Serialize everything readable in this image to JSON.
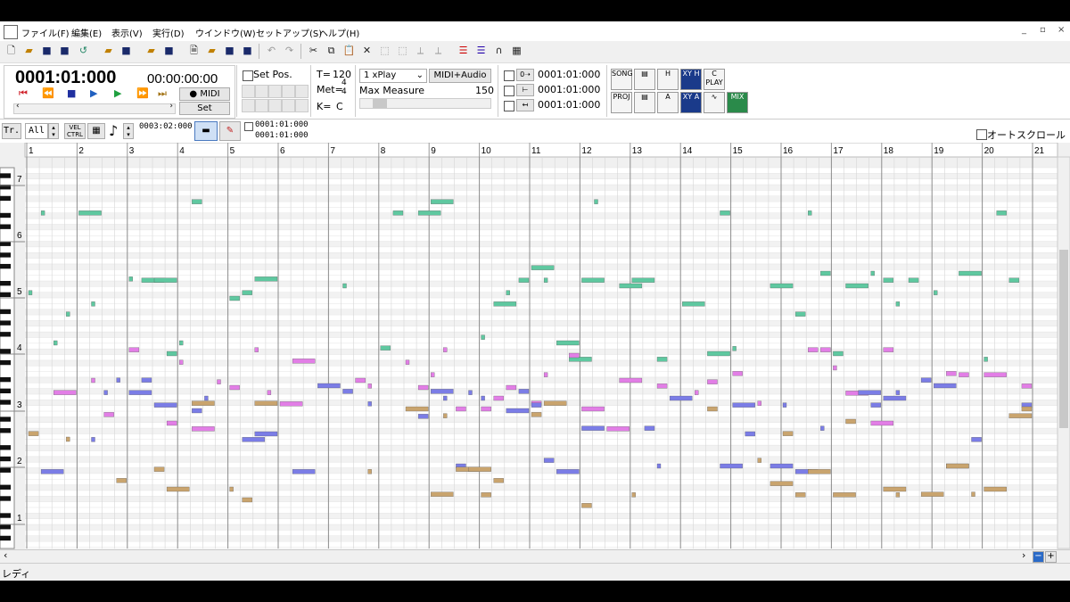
{
  "menu": [
    {
      "label": "ファイル(F)"
    },
    {
      "label": "編集(E)"
    },
    {
      "label": "表示(V)"
    },
    {
      "label": "実行(D)"
    },
    {
      "label": "ウインドウ(W)"
    },
    {
      "label": "セットアップ(S)"
    },
    {
      "label": "ヘルプ(H)"
    }
  ],
  "window_controls": {
    "minimize": "_",
    "restore": "▫",
    "close": "×"
  },
  "toolbar_icons": [
    "new-file-icon",
    "open-file-icon",
    "save-icon",
    "save-as-icon",
    "undo-save-icon",
    "open-folder-icon",
    "save-2-icon",
    "open-2-icon",
    "save-3-icon",
    "document-icon",
    "open-3-icon",
    "save-4-icon",
    "save-5-icon",
    "undo-icon",
    "redo-icon",
    "cut-icon",
    "copy-icon",
    "paste-icon",
    "delete-icon",
    "select-icon",
    "insert-icon",
    "quantize-icon",
    "humanize-icon",
    "list-icon",
    "list-2-icon",
    "loop-icon",
    "grid-icon"
  ],
  "transport": {
    "measure_position": "0001:01:000",
    "time": "00:00:00:00",
    "midi_label": "● MIDI",
    "set_label": "Set",
    "set_pos_label": "Set Pos.",
    "tempo_label": "T=",
    "tempo": "120",
    "meter_label": "Met=",
    "meter_num": "4",
    "meter_den": "4",
    "key_label": "K=",
    "key": "C",
    "play_mode": "1 xPlay",
    "midi_audio_label": "MIDI+Audio",
    "max_measure_label": "Max Measure",
    "max_measure": "150",
    "locators": [
      "0001:01:000",
      "0001:01:000",
      "0001:01:000"
    ]
  },
  "tool_icons": [
    {
      "name": "song-icon",
      "label": "SONG"
    },
    {
      "name": "track-list-icon",
      "label": ""
    },
    {
      "name": "mixer-h-icon",
      "label": "H"
    },
    {
      "name": "xy-h-icon",
      "label": "XY H"
    },
    {
      "name": "c-play-icon",
      "label": "C PLAY"
    },
    {
      "name": "proj-icon",
      "label": "PROJ"
    },
    {
      "name": "list-view-icon",
      "label": ""
    },
    {
      "name": "mixer-a-icon",
      "label": "A"
    },
    {
      "name": "xy-a-icon",
      "label": "XY A"
    },
    {
      "name": "wave-icon",
      "label": ""
    },
    {
      "name": "mix-icon",
      "label": "MIX"
    }
  ],
  "track_bar": {
    "tr_label": "Tr.",
    "track_select": "All",
    "vel_ctrl": "VEL CTRL",
    "cursor_position": "0003:02:000",
    "range_start": "0001:01:000",
    "range_end": "0001:01:000",
    "auto_scroll_label": "オートスクロール"
  },
  "ruler": {
    "measures": [
      "1",
      "2",
      "3",
      "4",
      "5",
      "6",
      "7",
      "8",
      "9",
      "10",
      "11",
      "12",
      "13",
      "14",
      "15",
      "16",
      "17",
      "18",
      "19",
      "20",
      "21"
    ]
  },
  "octave_labels": [
    "7",
    "6",
    "5",
    "4",
    "3",
    "2",
    "1"
  ],
  "status": {
    "text": "レディ"
  },
  "colors": {
    "green": "#5fc8a0",
    "pink": "#e27ee6",
    "blue": "#7b7de6",
    "tan": "#c9a46e",
    "grid_bg": "#ffffff",
    "selected_octave": "#f3f3f3"
  }
}
